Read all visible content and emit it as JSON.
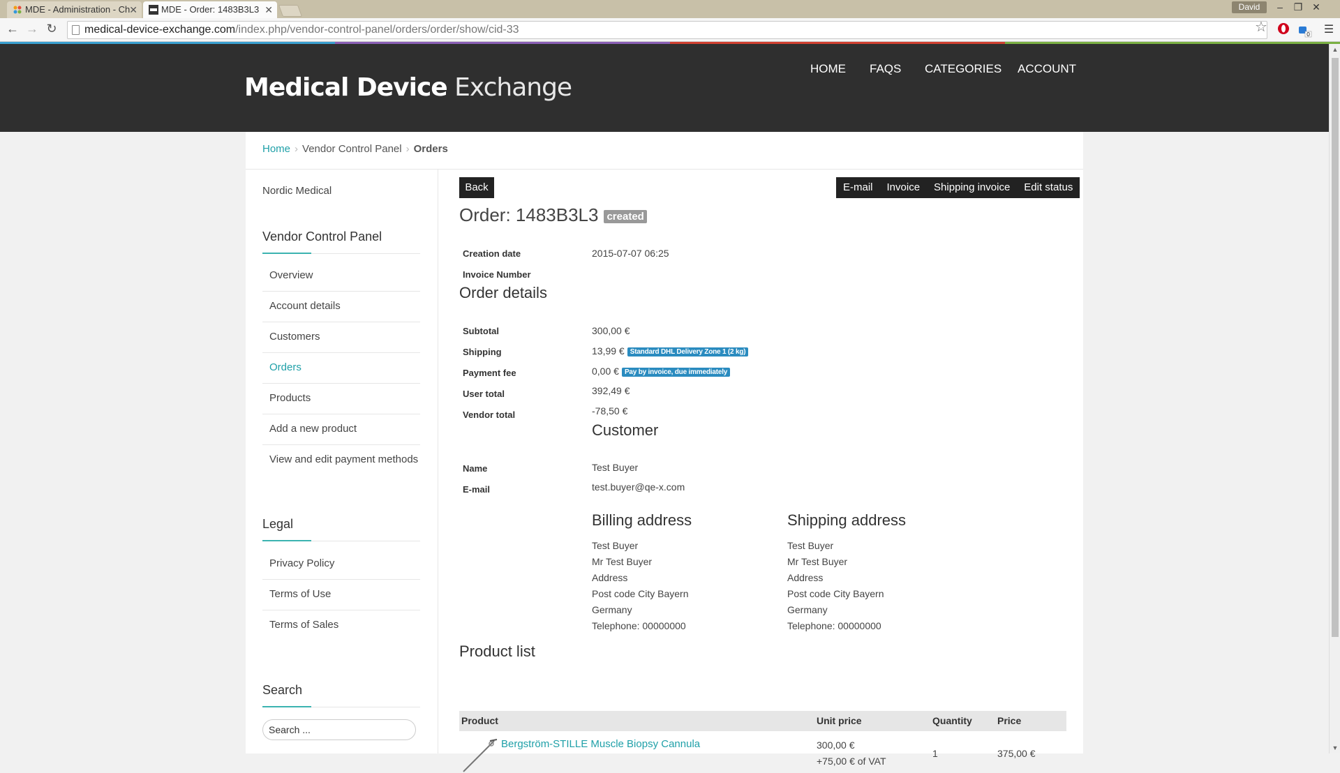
{
  "browser": {
    "tabs": [
      {
        "title": "MDE - Administration - Ch",
        "active": false
      },
      {
        "title": "MDE - Order: 1483B3L3",
        "active": true
      }
    ],
    "profile": "David",
    "url_host": "medical-device-exchange.com",
    "url_path": "/index.php/vendor-control-panel/orders/order/show/cid-33",
    "extension_badge": "0"
  },
  "site": {
    "logo_bold": "Medical Device",
    "logo_light": "Exchange",
    "nav": [
      "HOME",
      "FAQS",
      "CATEGORIES",
      "ACCOUNT"
    ]
  },
  "breadcrumb": {
    "home": "Home",
    "vendor_panel": "Vendor Control Panel",
    "current": "Orders"
  },
  "sidebar": {
    "vendor_name": "Nordic Medical",
    "vendor_panel_title": "Vendor Control Panel",
    "vendor_items": [
      "Overview",
      "Account details",
      "Customers",
      "Orders",
      "Products",
      "Add a new product",
      "View and edit payment methods"
    ],
    "active_item": "Orders",
    "legal_title": "Legal",
    "legal_items": [
      "Privacy Policy",
      "Terms of Use",
      "Terms of Sales"
    ],
    "search_title": "Search",
    "search_placeholder": "Search ..."
  },
  "actions": {
    "back": "Back",
    "email": "E-mail",
    "invoice": "Invoice",
    "shipping_invoice": "Shipping invoice",
    "edit_status": "Edit status"
  },
  "order": {
    "title": "Order: 1483B3L3",
    "status": "created",
    "creation_date_label": "Creation date",
    "creation_date": "2015-07-07 06:25",
    "invoice_number_label": "Invoice Number",
    "invoice_number": ""
  },
  "order_details": {
    "heading": "Order details",
    "subtotal_label": "Subtotal",
    "subtotal": "300,00 €",
    "shipping_label": "Shipping",
    "shipping": "13,99 €",
    "shipping_method": "Standard DHL Delivery Zone 1 (2 kg)",
    "payment_fee_label": "Payment fee",
    "payment_fee": "0,00 €",
    "payment_method": "Pay by invoice, due immediately",
    "user_total_label": "User total",
    "user_total": "392,49 €",
    "vendor_total_label": "Vendor total",
    "vendor_total": "-78,50 €"
  },
  "customer": {
    "heading": "Customer",
    "name_label": "Name",
    "name": "Test Buyer",
    "email_label": "E-mail",
    "email": "test.buyer@qe-x.com"
  },
  "billing_address": {
    "heading": "Billing address",
    "lines": [
      "Test Buyer",
      "Mr Test Buyer",
      "Address",
      "Post code City Bayern",
      "Germany",
      "Telephone: 00000000"
    ]
  },
  "shipping_address": {
    "heading": "Shipping address",
    "lines": [
      "Test Buyer",
      "Mr Test Buyer",
      "Address",
      "Post code City Bayern",
      "Germany",
      "Telephone: 00000000"
    ]
  },
  "product_list": {
    "heading": "Product list",
    "columns": [
      "Product",
      "Unit price",
      "Quantity",
      "Price"
    ],
    "rows": [
      {
        "product": "Bergström-STILLE Muscle Biopsy Cannula",
        "unit_price": "300,00 €",
        "vat": "+75,00 € of VAT",
        "quantity": "1",
        "price": "375,00 €"
      }
    ]
  },
  "colors": {
    "accent": "#1fa0a8",
    "header_bg": "#2f2f2f",
    "badge_blue": "#2a8bbf"
  }
}
